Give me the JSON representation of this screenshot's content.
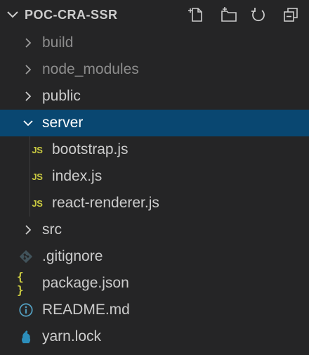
{
  "explorer": {
    "title": "POC-CRA-SSR",
    "actions": [
      {
        "name": "new-file-icon"
      },
      {
        "name": "new-folder-icon"
      },
      {
        "name": "refresh-icon"
      },
      {
        "name": "collapse-all-icon"
      }
    ]
  },
  "tree": {
    "build": {
      "label": "build"
    },
    "node_modules": {
      "label": "node_modules"
    },
    "public": {
      "label": "public"
    },
    "server": {
      "label": "server"
    },
    "bootstrap": {
      "label": "bootstrap.js",
      "badge": "JS"
    },
    "index": {
      "label": "index.js",
      "badge": "JS"
    },
    "react_renderer": {
      "label": "react-renderer.js",
      "badge": "JS"
    },
    "src": {
      "label": "src"
    },
    "gitignore": {
      "label": ".gitignore"
    },
    "package_json": {
      "label": "package.json",
      "badge": "{ }"
    },
    "readme": {
      "label": "README.md"
    },
    "yarn_lock": {
      "label": "yarn.lock"
    }
  },
  "colors": {
    "background": "#252526",
    "selected_row": "#094771",
    "js_yellow": "#cbcb41",
    "info_blue": "#519aba",
    "git_gray": "#41535b",
    "yarn_blue": "#2c8ebb"
  }
}
